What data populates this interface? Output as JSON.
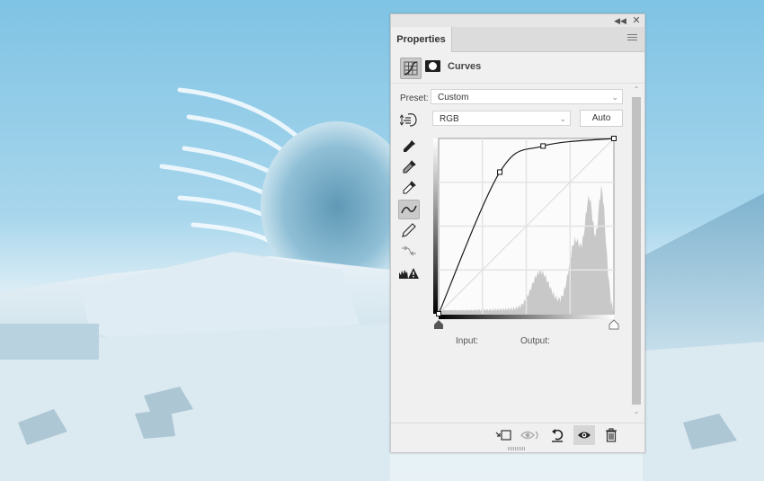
{
  "window": {
    "collapse_icon": "double-chevron-left-icon",
    "close_icon": "close-icon"
  },
  "panel": {
    "tab_label": "Properties",
    "menu_icon": "hamburger-menu-icon",
    "adjustment_type_icon": "curves-adjustment-icon",
    "mask_icon": "layer-mask-icon",
    "title": "Curves"
  },
  "preset": {
    "label": "Preset:",
    "value": "Custom"
  },
  "channel": {
    "value": "RGB",
    "auto_label": "Auto",
    "targeted_adjustment_icon": "hand-adjust-icon"
  },
  "tools": [
    {
      "name": "sample-black-point-eyedropper-icon",
      "active": false
    },
    {
      "name": "sample-gray-point-eyedropper-icon",
      "active": false
    },
    {
      "name": "sample-white-point-eyedropper-icon",
      "active": false
    },
    {
      "name": "edit-points-curve-icon",
      "active": true
    },
    {
      "name": "draw-pencil-icon",
      "active": false
    },
    {
      "name": "smooth-curve-icon",
      "active": false
    },
    {
      "name": "clipping-warning-icon",
      "active": false
    }
  ],
  "curve": {
    "points": [
      [
        0,
        0
      ],
      [
        89,
        206
      ],
      [
        152,
        244
      ],
      [
        255,
        255
      ]
    ],
    "range": [
      0,
      255
    ],
    "grid_divisions": 4
  },
  "readout": {
    "input_label": "Input:",
    "output_label": "Output:"
  },
  "footer": [
    {
      "name": "clip-to-layer-icon",
      "active": false
    },
    {
      "name": "view-previous-state-icon",
      "active": false
    },
    {
      "name": "reset-icon",
      "active": false
    },
    {
      "name": "toggle-visibility-eye-icon",
      "active": true
    },
    {
      "name": "trash-icon",
      "active": false
    }
  ]
}
